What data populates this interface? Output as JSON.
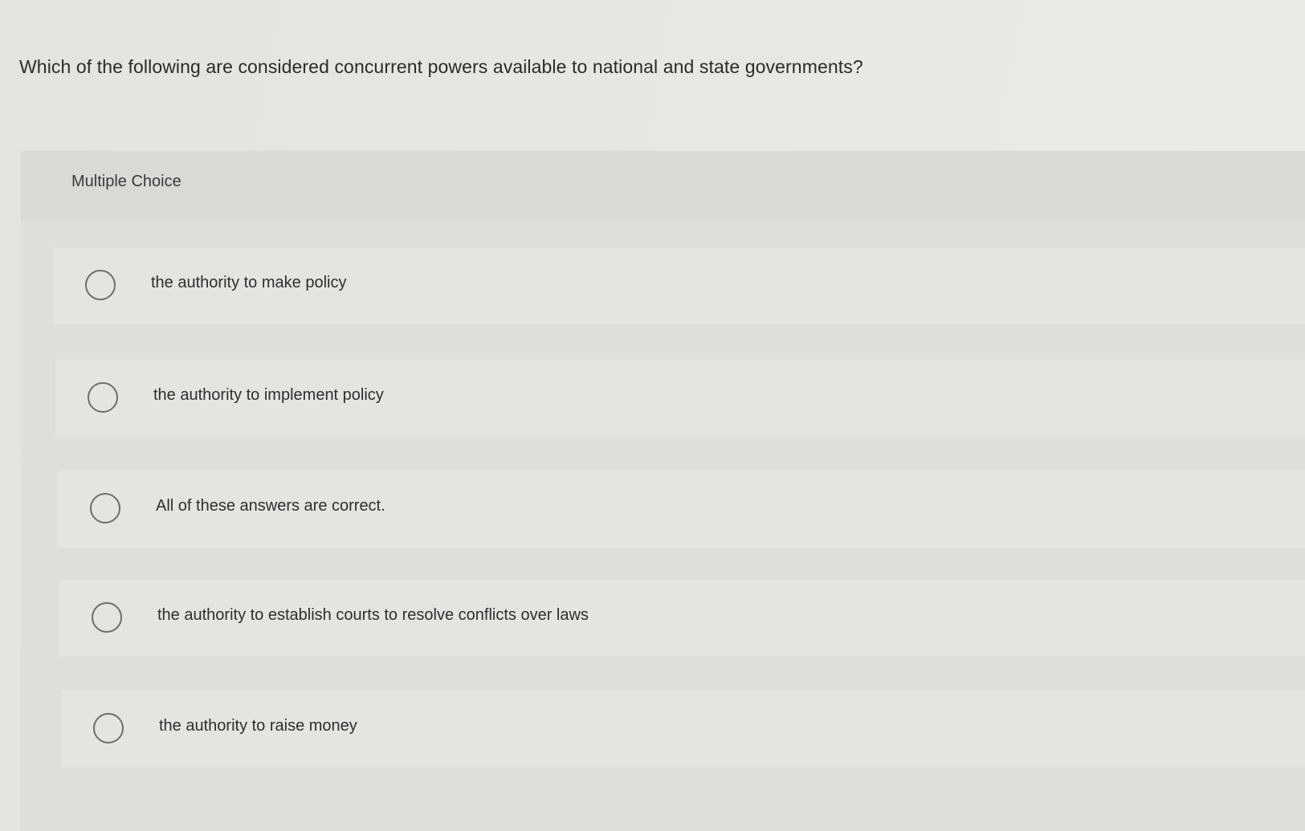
{
  "question": {
    "text": "Which of the following are considered concurrent powers available to national and state governments?"
  },
  "multiple_choice": {
    "label": "Multiple Choice",
    "options": [
      {
        "label": "the authority to make policy",
        "selected": false,
        "icon": "radio-circle-icon"
      },
      {
        "label": "the authority to implement policy",
        "selected": false,
        "icon": "radio-circle-icon"
      },
      {
        "label": "All of these answers are correct.",
        "selected": false,
        "icon": "radio-circle-icon"
      },
      {
        "label": "the authority to establish courts to resolve conflicts over laws",
        "selected": false,
        "icon": "radio-circle-icon"
      },
      {
        "label": "the authority to raise money",
        "selected": false,
        "icon": "radio-circle-icon"
      }
    ]
  }
}
